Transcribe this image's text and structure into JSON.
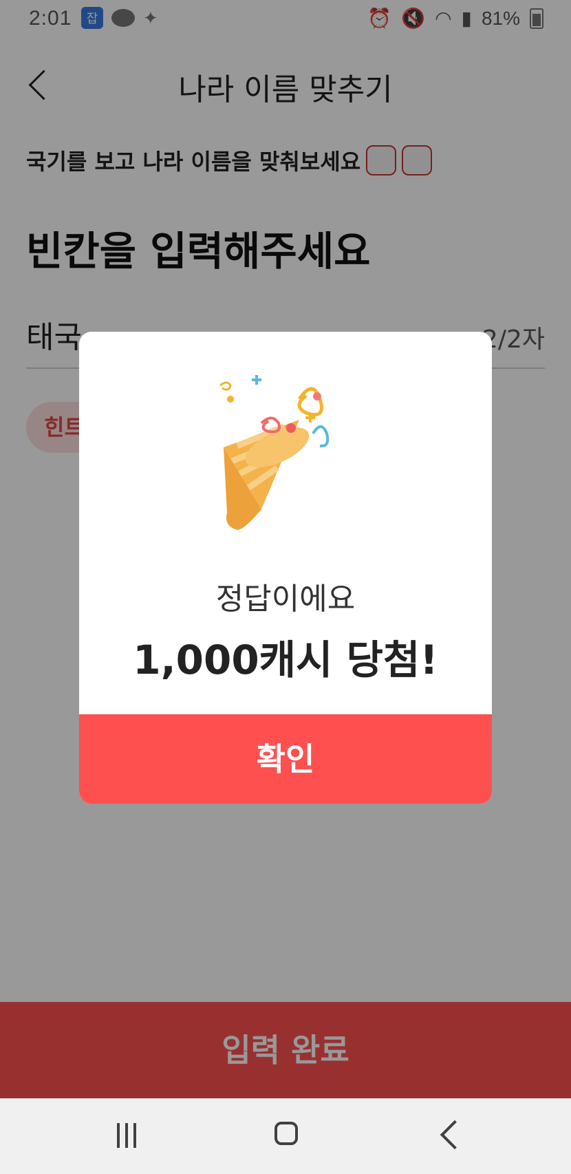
{
  "status_bar": {
    "time": "2:01",
    "app_badge": "잡",
    "battery": "81%"
  },
  "header": {
    "title": "나라 이름 맞추기"
  },
  "quiz": {
    "subtitle": "국기를 보고 나라 이름을 맞춰보세요",
    "heading": "빈칸을 입력해주세요",
    "answer_value": "태국",
    "answer_count": "2/2자",
    "hint_label": "힌트"
  },
  "footer": {
    "submit_label": "입력 완료"
  },
  "dialog": {
    "message": "정답이에요",
    "prize": "1,000캐시 당첨!",
    "confirm_label": "확인"
  },
  "colors": {
    "accent": "#ff5050",
    "overlay": "#000000"
  }
}
